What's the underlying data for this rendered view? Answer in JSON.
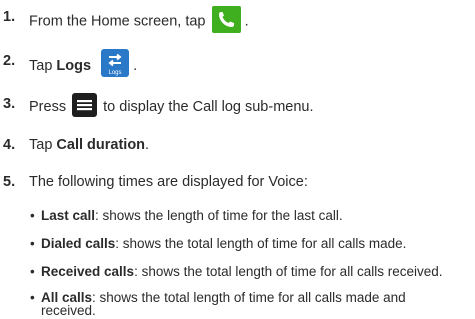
{
  "steps": [
    {
      "num": "1.",
      "before": "From the Home screen, tap",
      "after": "."
    },
    {
      "num": "2.",
      "before": "Tap ",
      "bold": "Logs",
      "after": "."
    },
    {
      "num": "3.",
      "before": "Press",
      "after": "to display the Call log sub-menu."
    },
    {
      "num": "4.",
      "before": "Tap ",
      "bold": "Call duration",
      "after": "."
    },
    {
      "num": "5.",
      "text": "The following times are displayed for Voice:"
    }
  ],
  "icons": {
    "phone": "phone-icon",
    "logs": "logs-icon",
    "logs_caption": "Logs",
    "menu": "menu-icon"
  },
  "bullet_mark": "•",
  "bullets": [
    {
      "bold": "Last call",
      "text": ": shows the length of time for the last call."
    },
    {
      "bold": "Dialed calls",
      "text": ": shows the total length of time for all calls made."
    },
    {
      "bold": "Received calls",
      "text": ": shows the total length of time for all calls received."
    },
    {
      "bold": "All calls",
      "text": ": shows the total length of time for all calls made and",
      "text2": "received."
    }
  ],
  "colors": {
    "phone_bg": "#3fae1f",
    "logs_bg": "#2a78c8",
    "menu_bg": "#1e1e1e"
  }
}
